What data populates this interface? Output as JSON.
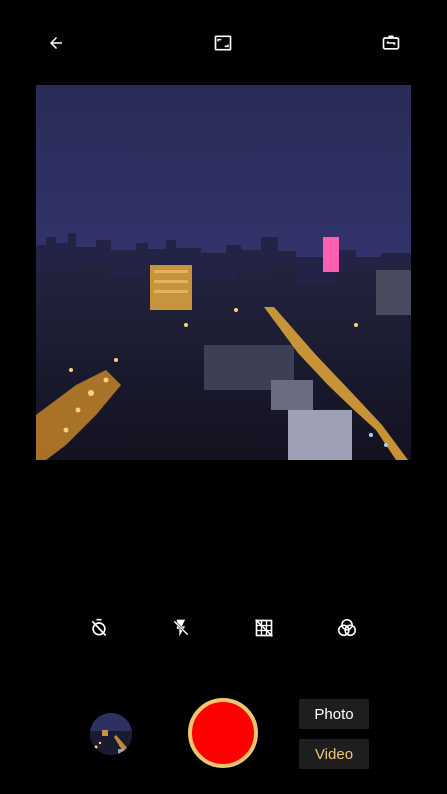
{
  "top_bar": {
    "icons": [
      "back-arrow-icon",
      "aspect-ratio-icon",
      "switch-camera-icon"
    ]
  },
  "quick_settings": {
    "icons": [
      "timer-off-icon",
      "flash-off-icon",
      "grid-off-icon",
      "filter-icon"
    ]
  },
  "preview": {
    "description_icon": "camera-preview-image"
  },
  "bottom": {
    "modes": {
      "photo_label": "Photo",
      "video_label": "Video",
      "selected": "Video"
    }
  },
  "colors": {
    "background": "#000000",
    "shutter": "#ff0000",
    "accent": "#f1c76d",
    "mode_bg": "#1e1e1e"
  }
}
